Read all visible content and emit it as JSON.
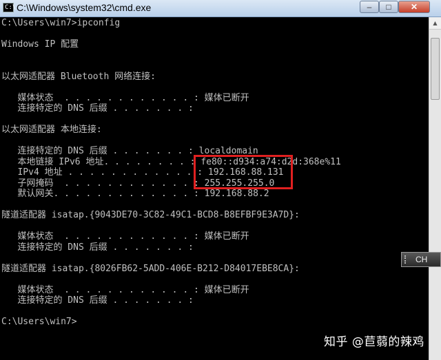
{
  "window": {
    "title": "C:\\Windows\\system32\\cmd.exe",
    "icon": "cmd-console-icon",
    "icon_glyph": "C:\\",
    "buttons": {
      "minimize": "–",
      "maximize": "□",
      "close": "✕"
    }
  },
  "console": {
    "lines": [
      "C:\\Users\\win7>ipconfig",
      "",
      "Windows IP 配置",
      "",
      "",
      "以太网适配器 Bluetooth 网络连接:",
      "",
      "   媒体状态  . . . . . . . . . . . . : 媒体已断开",
      "   连接特定的 DNS 后缀 . . . . . . . :",
      "",
      "以太网适配器 本地连接:",
      "",
      "   连接特定的 DNS 后缀 . . . . . . . : localdomain",
      "   本地链接 IPv6 地址. . . . . . . . : fe80::d934:a74:d2d:368e%11",
      "   IPv4 地址 . . . . . . . . . . . . : 192.168.88.131",
      "   子网掩码  . . . . . . . . . . . . : 255.255.255.0",
      "   默认网关. . . . . . . . . . . . . : 192.168.88.2",
      "",
      "隧道适配器 isatap.{9043DE70-3C82-49C1-BCD8-B8EFBF9E3A7D}:",
      "",
      "   媒体状态  . . . . . . . . . . . . : 媒体已断开",
      "   连接特定的 DNS 后缀 . . . . . . . :",
      "",
      "隧道适配器 isatap.{8026FB62-5ADD-406E-B212-D84017EBE8CA}:",
      "",
      "   媒体状态  . . . . . . . . . . . . : 媒体已断开",
      "   连接特定的 DNS 后缀 . . . . . . . :",
      "",
      "C:\\Users\\win7>"
    ]
  },
  "ime": {
    "label": "CH"
  },
  "watermark": "知乎 @苣蒻的辣鸡",
  "colors": {
    "console_bg": "#000000",
    "console_text": "#c0c0c0",
    "highlight": "#e02020"
  }
}
